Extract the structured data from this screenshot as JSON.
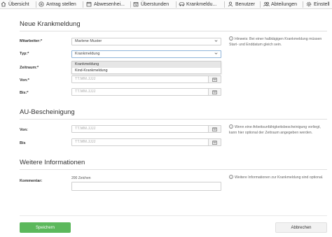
{
  "nav": {
    "items": [
      {
        "label": "Übersicht",
        "icon": "home-icon"
      },
      {
        "label": "Antrag stellen",
        "icon": "plus-circle-icon"
      },
      {
        "label": "Abwesenhei...",
        "icon": "calendar-icon"
      },
      {
        "label": "Überstunden",
        "icon": "calendar-clock-icon"
      },
      {
        "label": "Krankmeldu...",
        "icon": "car-icon"
      },
      {
        "label": "Benutzer",
        "icon": "user-icon"
      },
      {
        "label": "Abteilungen",
        "icon": "users-icon"
      },
      {
        "label": "Einstell",
        "icon": "gear-icon"
      }
    ]
  },
  "form": {
    "section1_title": "Neue Krankmeldung",
    "mitarbeiter": {
      "label": "Mitarbeiter:*",
      "value": "Marlene Muster"
    },
    "typ": {
      "label": "Typ:*",
      "value": "Krankmeldung",
      "options": [
        "Krankmeldung",
        "Kind-Krankmeldung"
      ],
      "highlighted_option": "Krankmeldung"
    },
    "zeitraum_label": "Zeitraum:*",
    "von": {
      "label": "Von:*",
      "placeholder": "TT.MM.JJJJ"
    },
    "bis": {
      "label": "Bis:*",
      "placeholder": "TT.MM.JJJJ"
    },
    "hint1": "Hinweis: Bei einer halbtägigen Krankmeldung müssen Start- und Enddatum gleich sein.",
    "section2_title": "AU-Bescheinigung",
    "au_von": {
      "label": "Von:",
      "placeholder": "TT.MM.JJJJ"
    },
    "au_bis": {
      "label": "Bis",
      "placeholder": "TT.MM.JJJJ"
    },
    "hint2": "Wenn eine Arbeitsunfähigkeitsbescheinigung vorliegt, kann hier optional der Zeitraum angegeben werden.",
    "section3_title": "Weitere Informationen",
    "kommentar": {
      "label": "Kommentar:",
      "counter": "200 Zeichen"
    },
    "hint3": "Weitere Informationen zur Krankmeldung sind optional."
  },
  "footer": {
    "save_label": "Speichern",
    "cancel_label": "Abbrechen"
  },
  "colors": {
    "save_button": "#5cb85c",
    "focus_border": "#8fb4d9",
    "dropdown_highlight": "#e6e6e6"
  }
}
